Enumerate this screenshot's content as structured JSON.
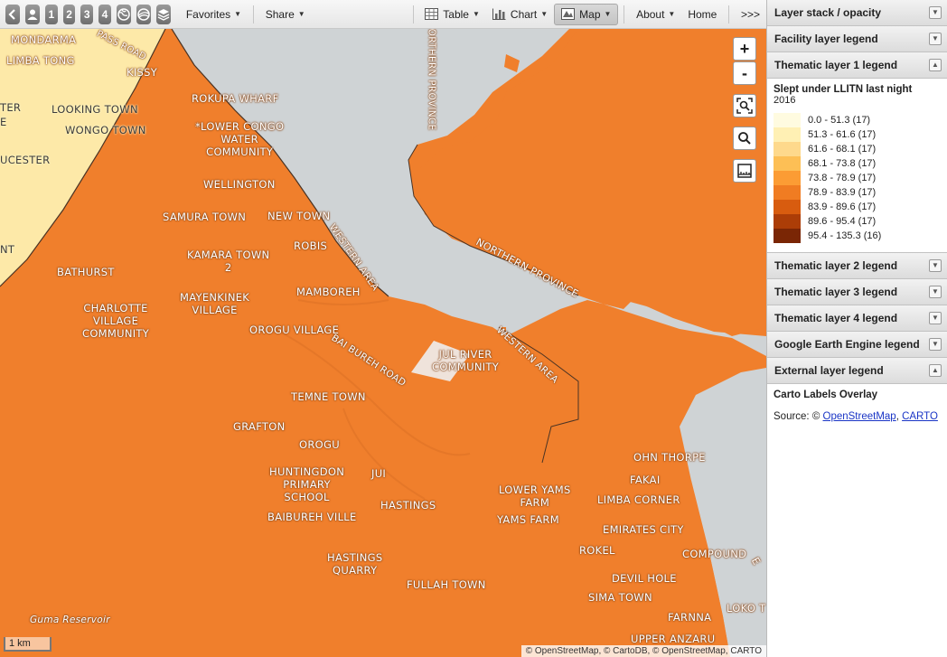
{
  "toolbar": {
    "numbered_buttons": [
      "1",
      "2",
      "3",
      "4"
    ],
    "favorites_label": "Favorites",
    "share_label": "Share",
    "table_label": "Table",
    "chart_label": "Chart",
    "map_label": "Map",
    "about_label": "About",
    "home_label": "Home",
    "more_label": ">>>"
  },
  "map": {
    "zoom_in_label": "+",
    "zoom_out_label": "-",
    "scale_label": "1 km",
    "attribution": "© OpenStreetMap, © CartoDB, © OpenStreetMap, CARTO",
    "colors": {
      "land_fill": "#f07f2c",
      "water": "#cfd3d5",
      "light_class": "#fde9a8",
      "boundary": "#4a3324"
    },
    "labels": [
      "MONDARMA",
      "PASS ROAD",
      "LIMBA TONG",
      "KISSY",
      "TER",
      "E",
      "LOOKING TOWN",
      "WONGO TOWN",
      "UCESTER",
      "NT",
      "ROKUPA WHARF",
      "*LOWER CONGO\nWATER\nCOMMUNITY",
      "WELLINGTON",
      "SAMURA TOWN",
      "NEW TOWN",
      "ROBIS",
      "KAMARA TOWN\n2",
      "BATHURST",
      "MAMBOREH",
      "CHARLOTTE\nVILLAGE\nCOMMUNITY",
      "MAYENKINEK\nVILLAGE",
      "OROGU VILLAGE",
      "BAI BUREH ROAD",
      "JUL RIVER\nCOMMUNITY",
      "TEMNE TOWN",
      "GRAFTON",
      "OROGU",
      "HUNTINGDON\nPRIMARY\nSCHOOL",
      "JUI",
      "HASTINGS",
      "BAIBUREH VILLE",
      "LOWER YAMS\nFARM",
      "YAMS FARM",
      "OHN THORPE",
      "FAKAI",
      "LIMBA CORNER",
      "EMIRATES CITY",
      "ROKEL",
      "COMPOUND",
      "HASTINGS\nQUARRY",
      "DEVIL HOLE",
      "FULLAH TOWN",
      "SIMA TOWN",
      "LOKO T",
      "FARNNA",
      "UPPER ANZARU",
      "Guma Reservoir",
      "NORTHERN PROVINCE",
      "WESTERN AREA",
      "WESTERN AREA",
      "NORTHERN PROVINCE",
      "E"
    ]
  },
  "panel": {
    "sections": {
      "layer_stack": "Layer stack / opacity",
      "facility_legend": "Facility layer legend",
      "thematic_1": "Thematic layer 1 legend",
      "thematic_2": "Thematic layer 2 legend",
      "thematic_3": "Thematic layer 3 legend",
      "thematic_4": "Thematic layer 4 legend",
      "gee_legend": "Google Earth Engine legend",
      "external_legend": "External layer legend"
    },
    "legend": {
      "title": "Slept under LLITN last night",
      "period": "2016",
      "classes": [
        {
          "label": "0.0 - 51.3 (17)",
          "color": "#fffbe0"
        },
        {
          "label": "51.3 - 61.6 (17)",
          "color": "#fff0b4"
        },
        {
          "label": "61.6 - 68.1 (17)",
          "color": "#fed98c"
        },
        {
          "label": "68.1 - 73.8 (17)",
          "color": "#fdbf55"
        },
        {
          "label": "73.8 - 78.9 (17)",
          "color": "#fc9c34"
        },
        {
          "label": "78.9 - 83.9 (17)",
          "color": "#f07c22"
        },
        {
          "label": "83.9 - 89.6 (17)",
          "color": "#d85c0f"
        },
        {
          "label": "89.6 - 95.4 (17)",
          "color": "#ac3d07"
        },
        {
          "label": "95.4 - 135.3 (16)",
          "color": "#7a2605"
        }
      ]
    },
    "external": {
      "title": "Carto Labels Overlay",
      "source_prefix": "Source: © ",
      "link_osm": "OpenStreetMap",
      "separator": ", ",
      "link_carto": "CARTO"
    }
  }
}
